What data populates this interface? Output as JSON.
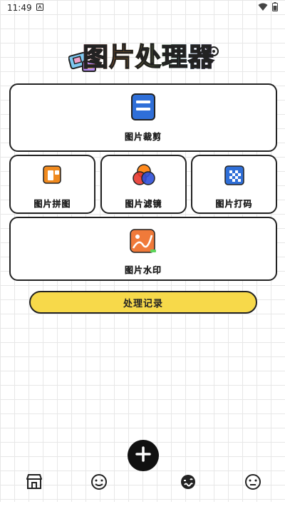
{
  "status_bar": {
    "time": "11:49"
  },
  "app": {
    "title": "图片处理器"
  },
  "cards": {
    "crop": {
      "label": "图片裁剪"
    },
    "collage": {
      "label": "图片拼图"
    },
    "filter": {
      "label": "图片滤镜"
    },
    "mosaic": {
      "label": "图片打码"
    },
    "watermark": {
      "label": "图片水印"
    }
  },
  "record_button": {
    "label": "处理记录"
  },
  "bottom_nav": {
    "items": [
      {
        "icon": "store-icon"
      },
      {
        "icon": "smile-icon"
      },
      {
        "icon": "wavy-face-icon",
        "active": true
      },
      {
        "icon": "neutral-face-icon"
      }
    ]
  },
  "colors": {
    "accent_yellow": "#f7d94a",
    "crop_blue": "#2f6fd8",
    "collage_orange": "#f08a1f",
    "watermark_orange": "#f07a3a",
    "mosaic_blue": "#2f6fd8"
  }
}
